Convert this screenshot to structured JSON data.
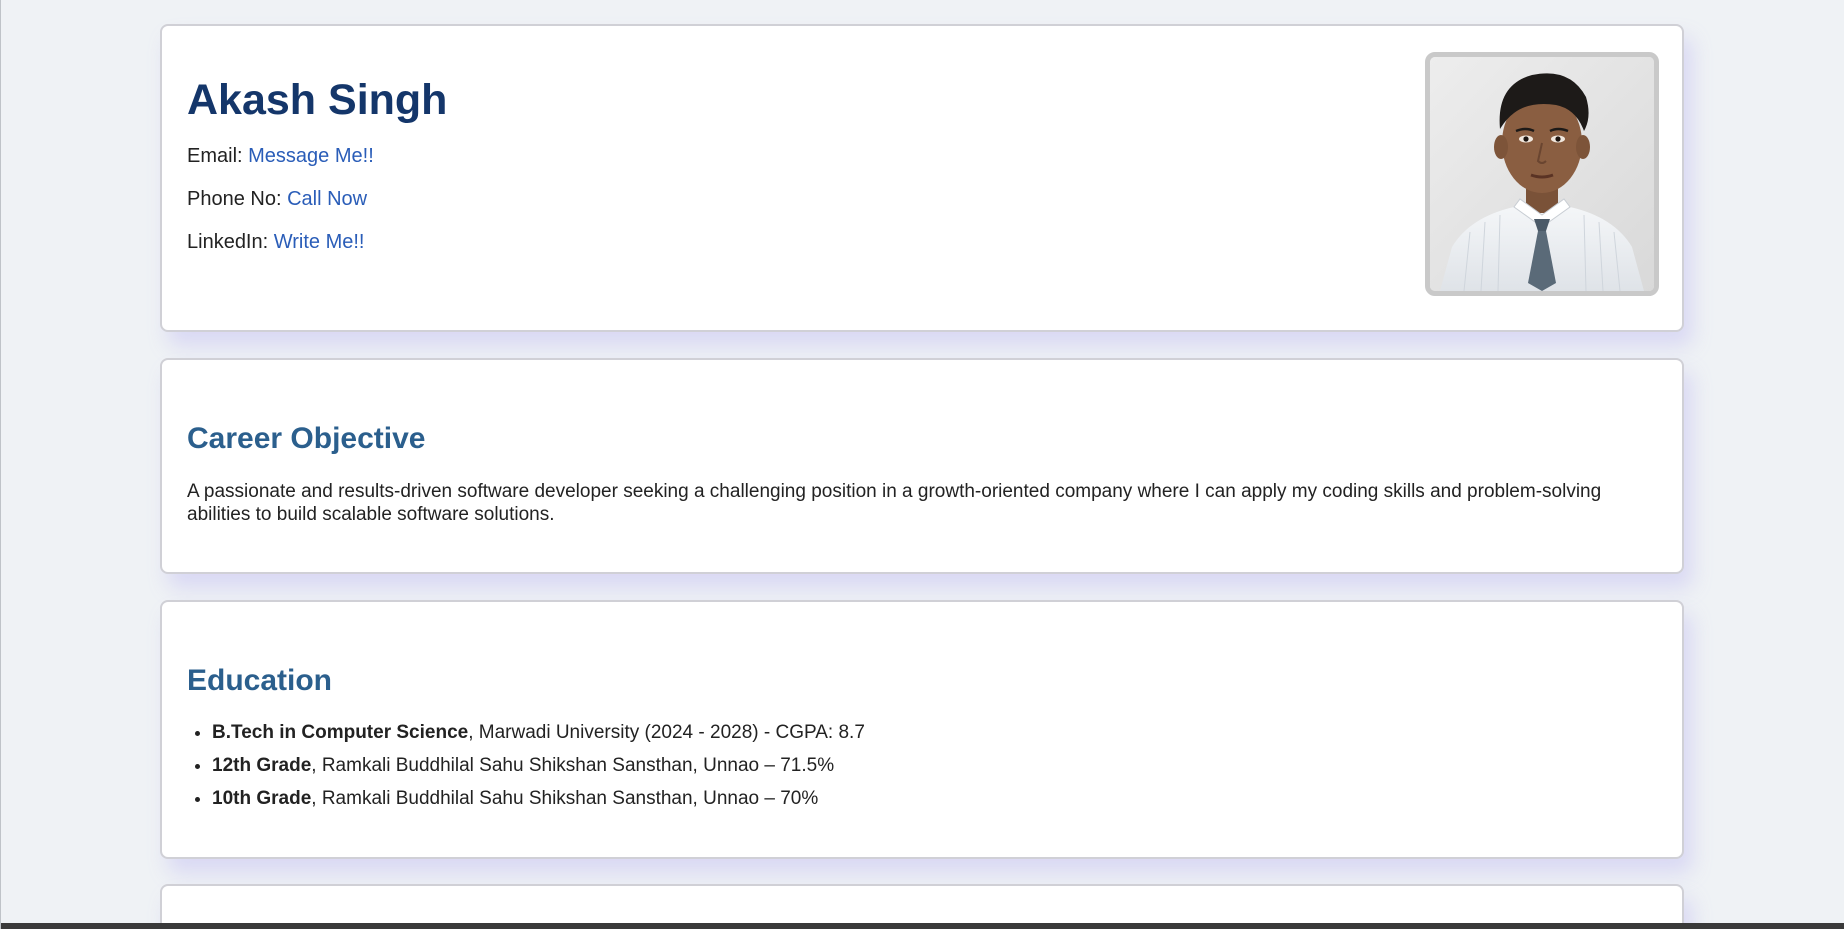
{
  "header": {
    "name": "Akash Singh",
    "email_label": "Email:",
    "email_link": "Message Me!!",
    "phone_label": "Phone No:",
    "phone_link": "Call Now",
    "linkedin_label": "LinkedIn:",
    "linkedin_link": "Write Me!!"
  },
  "objective": {
    "title": "Career Objective",
    "text": "A passionate and results-driven software developer seeking a challenging position in a growth-oriented company where I can apply my coding skills and problem-solving abilities to build scalable software solutions."
  },
  "education": {
    "title": "Education",
    "items": [
      {
        "degree": "B.Tech in Computer Science",
        "detail": ", Marwadi University (2024 - 2028) - CGPA: 8.7"
      },
      {
        "degree": "12th Grade",
        "detail": ", Ramkali Buddhilal Sahu Shikshan Sansthan, Unnao – 71.5%"
      },
      {
        "degree": "10th Grade",
        "detail": ", Ramkali Buddhilal Sahu Shikshan Sansthan, Unnao – 70%"
      }
    ]
  },
  "colors": {
    "name": "#14366a",
    "section_title": "#2b5f8d",
    "link": "#2a5db8",
    "background": "#eff2f5"
  }
}
